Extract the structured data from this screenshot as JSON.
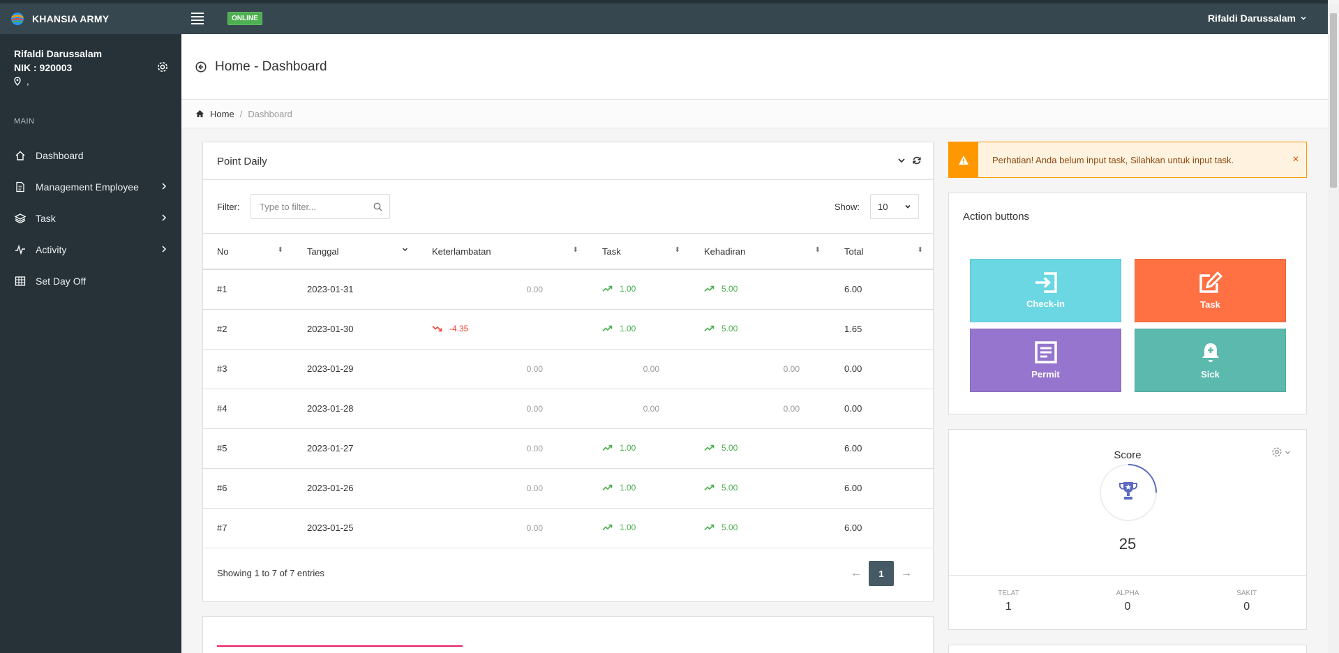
{
  "topbar": {
    "brand": "KHANSIA ARMY",
    "status_badge": "ONLINE",
    "user_name": "Rifaldi Darussalam"
  },
  "sidebar": {
    "profile": {
      "name": "Rifaldi Darussalam",
      "nik": "NIK : 920003",
      "location": ","
    },
    "section_label": "MAIN",
    "items": [
      {
        "label": "Dashboard",
        "icon": "home-icon",
        "has_children": false
      },
      {
        "label": "Management Employee",
        "icon": "document-icon",
        "has_children": true
      },
      {
        "label": "Task",
        "icon": "layers-icon",
        "has_children": true
      },
      {
        "label": "Activity",
        "icon": "pulse-icon",
        "has_children": true
      },
      {
        "label": "Set Day Off",
        "icon": "table-icon",
        "has_children": false
      }
    ]
  },
  "page": {
    "title": "Home - Dashboard",
    "breadcrumb": {
      "home": "Home",
      "separator": "/",
      "current": "Dashboard"
    }
  },
  "point_daily": {
    "title": "Point Daily",
    "filter_label": "Filter:",
    "filter_placeholder": "Type to filter...",
    "show_label": "Show:",
    "show_value": "10",
    "columns": [
      "No",
      "Tanggal",
      "Keterlambatan",
      "Task",
      "Kehadiran",
      "Total"
    ],
    "rows": [
      {
        "no": "#1",
        "tanggal": "2023-01-31",
        "late": "0.00",
        "late_trend": "none",
        "task": "1.00",
        "task_trend": "up",
        "hadir": "5.00",
        "hadir_trend": "up",
        "total": "6.00"
      },
      {
        "no": "#2",
        "tanggal": "2023-01-30",
        "late": "-4.35",
        "late_trend": "down",
        "task": "1.00",
        "task_trend": "up",
        "hadir": "5.00",
        "hadir_trend": "up",
        "total": "1.65"
      },
      {
        "no": "#3",
        "tanggal": "2023-01-29",
        "late": "0.00",
        "late_trend": "none",
        "task": "0.00",
        "task_trend": "none",
        "hadir": "0.00",
        "hadir_trend": "none",
        "total": "0.00"
      },
      {
        "no": "#4",
        "tanggal": "2023-01-28",
        "late": "0.00",
        "late_trend": "none",
        "task": "0.00",
        "task_trend": "none",
        "hadir": "0.00",
        "hadir_trend": "none",
        "total": "0.00"
      },
      {
        "no": "#5",
        "tanggal": "2023-01-27",
        "late": "0.00",
        "late_trend": "none",
        "task": "1.00",
        "task_trend": "up",
        "hadir": "5.00",
        "hadir_trend": "up",
        "total": "6.00"
      },
      {
        "no": "#6",
        "tanggal": "2023-01-26",
        "late": "0.00",
        "late_trend": "none",
        "task": "1.00",
        "task_trend": "up",
        "hadir": "5.00",
        "hadir_trend": "up",
        "total": "6.00"
      },
      {
        "no": "#7",
        "tanggal": "2023-01-25",
        "late": "0.00",
        "late_trend": "none",
        "task": "1.00",
        "task_trend": "up",
        "hadir": "5.00",
        "hadir_trend": "up",
        "total": "6.00"
      }
    ],
    "footer_info": "Showing 1 to 7 of 7 entries",
    "pager": {
      "prev": "←",
      "current": "1",
      "next": "→"
    }
  },
  "alert": {
    "text": "Perhatian! Anda belum input task, Silahkan untuk input task.",
    "close": "×"
  },
  "actions": {
    "title": "Action buttons",
    "buttons": [
      {
        "label": "Check-in",
        "icon": "enter-icon",
        "color": "#6ad7e3"
      },
      {
        "label": "Task",
        "icon": "edit-icon",
        "color": "#ff7043"
      },
      {
        "label": "Permit",
        "icon": "form-icon",
        "color": "#9575cd"
      },
      {
        "label": "Sick",
        "icon": "bell-plus-icon",
        "color": "#5bb9ad"
      }
    ]
  },
  "score": {
    "title": "Score",
    "value": "25",
    "progress_fraction": 0.25,
    "stats": [
      {
        "label": "TELAT",
        "value": "1"
      },
      {
        "label": "ALPHA",
        "value": "0"
      },
      {
        "label": "SAKIT",
        "value": "0"
      }
    ]
  },
  "colors": {
    "topbar": "#37474f",
    "sidebar": "#263238",
    "trend_up": "#4caf50",
    "trend_down": "#f44336",
    "alert": "#ff9800",
    "pager_active": "#455a64",
    "score_ring": "#5c6bc0"
  }
}
